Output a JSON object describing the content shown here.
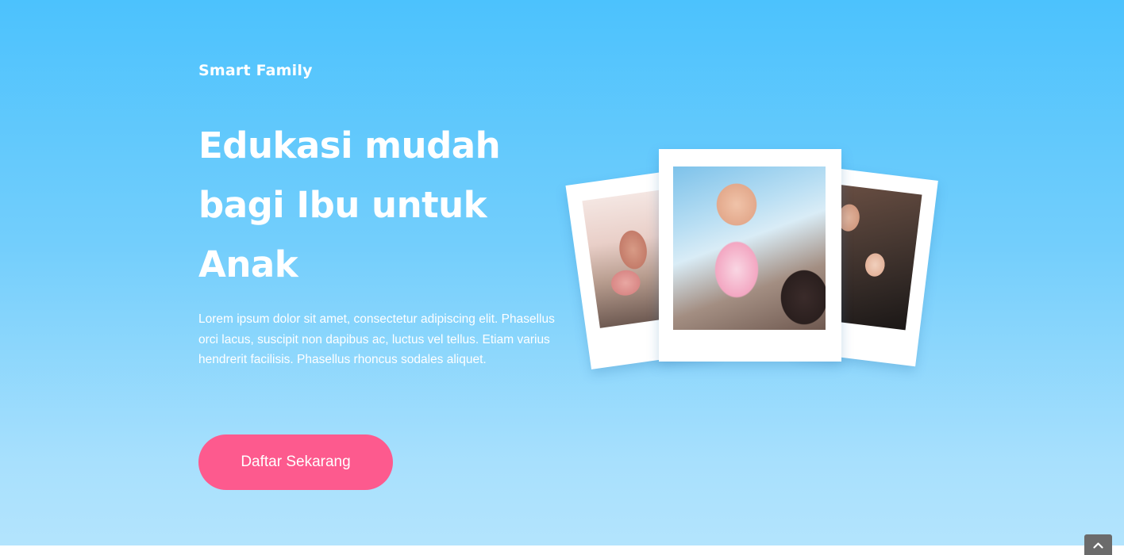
{
  "brand": {
    "name": "Smart Family"
  },
  "hero": {
    "headline": "Edukasi mudah bagi Ibu untuk Anak",
    "lead": "Lorem ipsum dolor sit amet, consectetur adipiscing elit. Phasellus orci lacus, suscipit non dapibus ac, luctus vel tellus. Etiam varius hendrerit facilisis. Phasellus rhoncus sodales aliquet.",
    "cta_label": "Daftar Sekarang"
  },
  "colors": {
    "background_top": "#4cc2fd",
    "background_bottom": "#b3e4fd",
    "cta": "#fd5a8e",
    "text": "#ffffff"
  },
  "gallery": {
    "photos": [
      "mother-child-photo",
      "baby-lifted-photo",
      "family-photo"
    ]
  },
  "scroll_top": {
    "icon": "chevron-up-icon"
  }
}
